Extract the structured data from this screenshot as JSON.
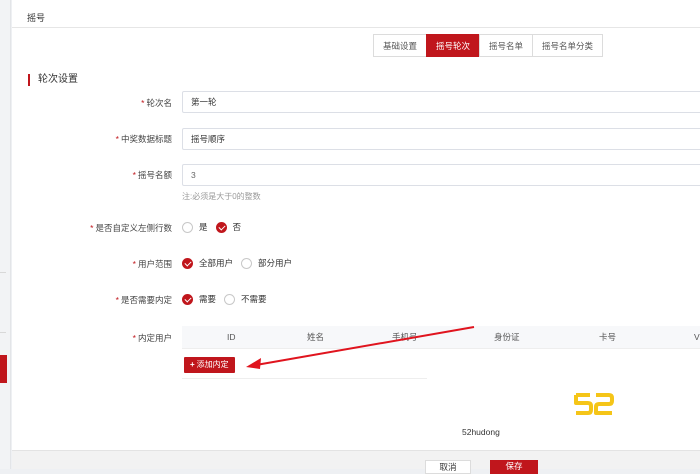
{
  "window": {
    "title": "摇号"
  },
  "tabs": [
    {
      "label": "基础设置",
      "active": false
    },
    {
      "label": "摇号轮次",
      "active": true
    },
    {
      "label": "摇号名单",
      "active": false
    },
    {
      "label": "摇号名单分类",
      "active": false
    }
  ],
  "section": {
    "title": "轮次设置"
  },
  "form": {
    "round_name": {
      "label": "轮次名",
      "value": "第一轮"
    },
    "prize_title": {
      "label": "中奖数据标题",
      "value": "摇号顺序"
    },
    "quota": {
      "label": "摇号名额",
      "value": "3",
      "hint": "注:必须是大于0的整数"
    },
    "custom_rows": {
      "label": "是否自定义左侧行数",
      "options": [
        "是",
        "否"
      ],
      "selected": "否"
    },
    "user_scope": {
      "label": "用户范围",
      "options": [
        "全部用户",
        "部分用户"
      ],
      "selected": "全部用户"
    },
    "internal_required": {
      "label": "是否需要内定",
      "options": [
        "需要",
        "不需要"
      ],
      "selected": "需要"
    },
    "internal_users": {
      "label": "内定用户",
      "columns": [
        "ID",
        "姓名",
        "手机号",
        "身份证",
        "卡号",
        "V"
      ],
      "add_label": "添加内定"
    }
  },
  "footer": {
    "cancel_label": "取消",
    "save_label": "保存"
  },
  "watermark": {
    "logo": "52",
    "text": "52hudong"
  },
  "colors": {
    "accent": "#c0161c",
    "watermark": "#f5c518"
  },
  "icons": {
    "add": "plus-icon",
    "arrow": "annotation-arrow"
  }
}
